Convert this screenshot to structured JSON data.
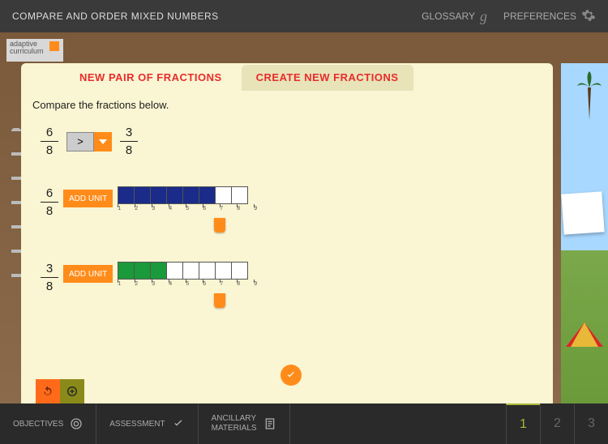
{
  "header": {
    "title": "COMPARE AND ORDER MIXED NUMBERS",
    "glossary": "GLOSSARY",
    "preferences": "PREFERENCES"
  },
  "logo_text": "adaptive curriculum",
  "tabs": {
    "active": "NEW PAIR OF FRACTIONS",
    "inactive": "CREATE NEW FRACTIONS"
  },
  "instruction": "Compare the fractions below.",
  "comparison": {
    "left": {
      "num": "6",
      "den": "8"
    },
    "op": ">",
    "right": {
      "num": "3",
      "den": "8"
    }
  },
  "bars": [
    {
      "frac": {
        "num": "6",
        "den": "8"
      },
      "add_label": "ADD UNIT",
      "filled": 6,
      "total": 8,
      "color": "blue",
      "ticks": [
        "1",
        "2",
        "3",
        "4",
        "5",
        "6",
        "7",
        "8",
        "9"
      ],
      "slider_at": 7
    },
    {
      "frac": {
        "num": "3",
        "den": "8"
      },
      "add_label": "ADD UNIT",
      "filled": 3,
      "total": 8,
      "color": "green",
      "ticks": [
        "1",
        "2",
        "3",
        "4",
        "5",
        "6",
        "7",
        "8",
        "9"
      ],
      "slider_at": 7
    }
  ],
  "footer": {
    "objectives": "OBJECTIVES",
    "assessment": "ASSESSMENT",
    "ancillary": "ANCILLARY\nMATERIALS",
    "pages": [
      "1",
      "2",
      "3"
    ],
    "active_page": 0
  },
  "colors": {
    "accent": "#ff8c1a",
    "blue": "#1a2b8a",
    "green": "#1a9a3a"
  }
}
